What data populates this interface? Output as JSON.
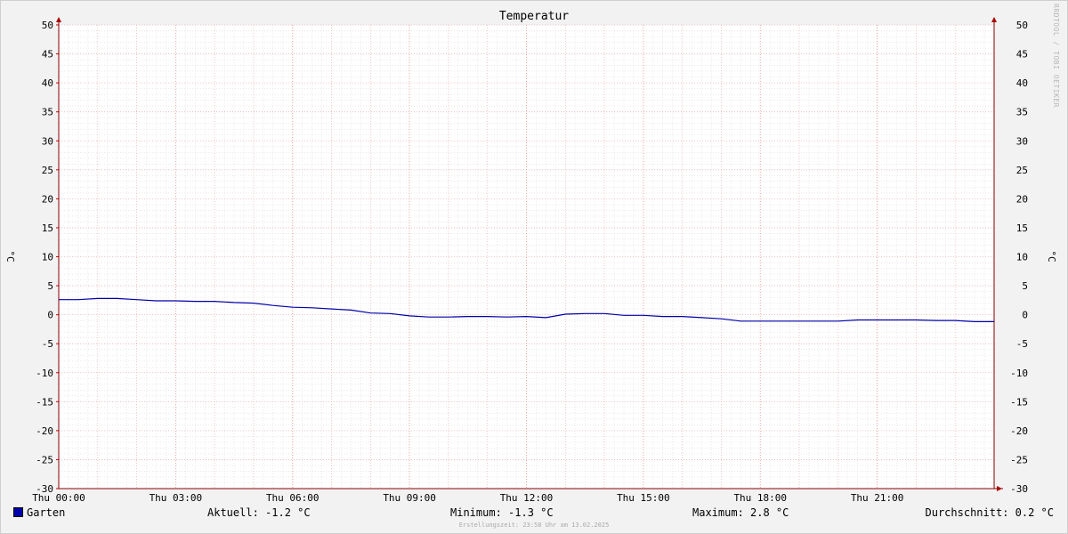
{
  "chart_data": {
    "type": "line",
    "title": "Temperatur",
    "ylabel": "°C",
    "ylim": [
      -30,
      50
    ],
    "yticks": [
      50,
      45,
      40,
      35,
      30,
      25,
      20,
      15,
      10,
      5,
      0,
      -5,
      -10,
      -15,
      -20,
      -25,
      -30
    ],
    "xlim": [
      0,
      24
    ],
    "xticks": [
      {
        "x": 0,
        "label": "Thu 00:00"
      },
      {
        "x": 3,
        "label": "Thu 03:00"
      },
      {
        "x": 6,
        "label": "Thu 06:00"
      },
      {
        "x": 9,
        "label": "Thu 09:00"
      },
      {
        "x": 12,
        "label": "Thu 12:00"
      },
      {
        "x": 15,
        "label": "Thu 15:00"
      },
      {
        "x": 18,
        "label": "Thu 18:00"
      },
      {
        "x": 21,
        "label": "Thu 21:00"
      }
    ],
    "grid": true,
    "series": [
      {
        "name": "Garten",
        "color": "#0000aa",
        "x": [
          0,
          0.5,
          1,
          1.5,
          2,
          2.5,
          3,
          3.5,
          4,
          4.5,
          5,
          5.5,
          6,
          6.5,
          7,
          7.5,
          8,
          8.5,
          9,
          9.5,
          10,
          10.5,
          11,
          11.5,
          12,
          12.5,
          13,
          13.5,
          14,
          14.5,
          15,
          15.5,
          16,
          16.5,
          17,
          17.5,
          18,
          18.5,
          19,
          19.5,
          20,
          20.5,
          21,
          21.5,
          22,
          22.5,
          23,
          23.5,
          24
        ],
        "y": [
          2.6,
          2.6,
          2.8,
          2.8,
          2.6,
          2.4,
          2.4,
          2.3,
          2.3,
          2.1,
          2.0,
          1.6,
          1.3,
          1.2,
          1.0,
          0.8,
          0.3,
          0.2,
          -0.2,
          -0.4,
          -0.4,
          -0.3,
          -0.3,
          -0.4,
          -0.3,
          -0.5,
          0.1,
          0.2,
          0.2,
          -0.1,
          -0.1,
          -0.3,
          -0.3,
          -0.5,
          -0.7,
          -1.1,
          -1.1,
          -1.1,
          -1.1,
          -1.1,
          -1.1,
          -0.9,
          -0.9,
          -0.9,
          -0.9,
          -1.0,
          -1.0,
          -1.2,
          -1.2
        ]
      }
    ]
  },
  "watermark": "RRDTOOL / TOBI OETIKER",
  "legend": {
    "name": "Garten",
    "current": "Aktuell: -1.2 °C",
    "min": "Minimum: -1.3 °C",
    "max": "Maximum: 2.8 °C",
    "avg": "Durchschnitt: 0.2 °C"
  },
  "footer": "Erstellungszeit: 23:58 Uhr am 13.02.2025"
}
